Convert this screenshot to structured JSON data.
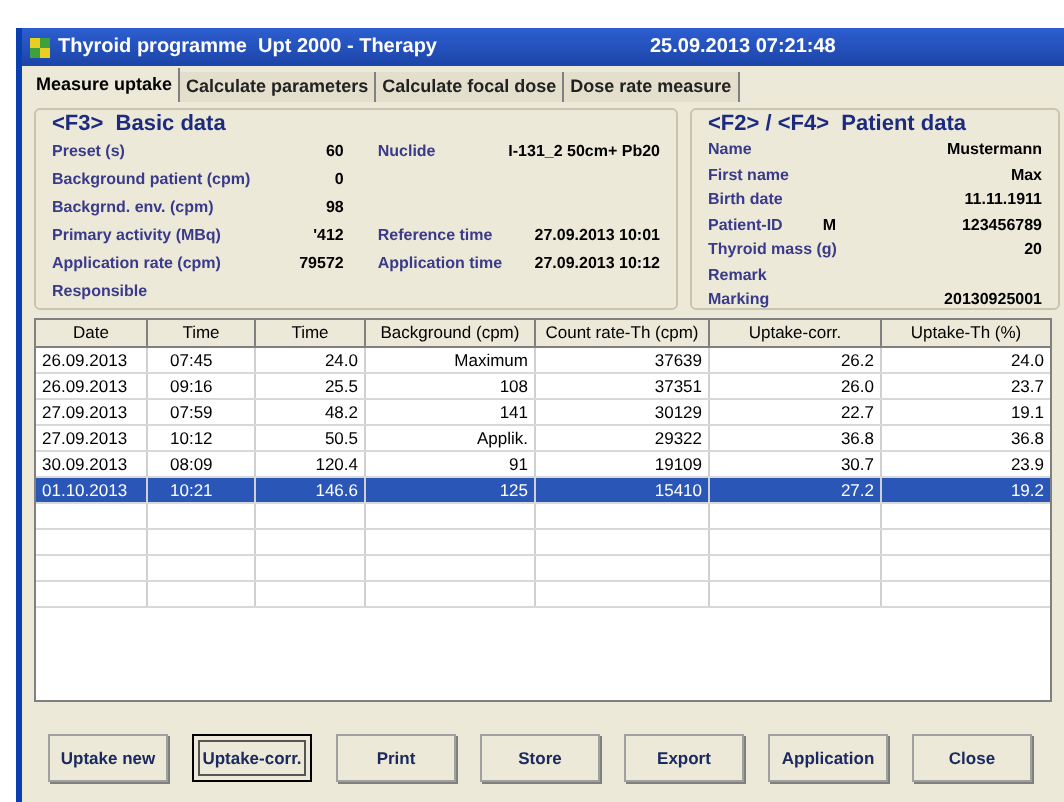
{
  "window": {
    "title": "Thyroid programme  Upt 2000 - Therapy",
    "datetime": "25.09.2013 07:21:48"
  },
  "tabs": [
    {
      "label": "Measure uptake",
      "selected": true
    },
    {
      "label": "Calculate parameters",
      "selected": false
    },
    {
      "label": "Calculate focal dose",
      "selected": false
    },
    {
      "label": "Dose rate measure",
      "selected": false
    }
  ],
  "basic_data": {
    "title": "<F3>  Basic data",
    "fields": [
      {
        "label": "Preset (s)",
        "value": "60"
      },
      {
        "label": "Background patient (cpm)",
        "value": "0"
      },
      {
        "label": "Backgrnd. env. (cpm)",
        "value": "98"
      },
      {
        "label": "Primary activity (MBq)",
        "value": "'412"
      },
      {
        "label": "Application rate (cpm)",
        "value": "79572"
      },
      {
        "label": "Responsible"
      }
    ],
    "side_fields": [
      {
        "label": "Nuclide",
        "value": "I-131_2 50cm+ Pb20"
      },
      {
        "label": "Reference time",
        "value": "27.09.2013 10:01"
      },
      {
        "label": "Application time",
        "value": "27.09.2013 10:12"
      }
    ]
  },
  "patient_data": {
    "title": "<F2> / <F4>  Patient data",
    "fields": [
      {
        "label": "Name",
        "value": "Mustermann"
      },
      {
        "label": "First name",
        "value": "Max"
      },
      {
        "label": "Birth date",
        "value": "11.11.1911"
      },
      {
        "label": "Patient-ID",
        "extra": "M",
        "value": "123456789"
      },
      {
        "label": "Thyroid mass (g)",
        "value": "20"
      },
      {
        "label": "Remark"
      },
      {
        "label": "Marking",
        "value": "20130925001"
      }
    ]
  },
  "table": {
    "columns": [
      "Date",
      "Time",
      "Time",
      "Background (cpm)",
      "Count rate-Th (cpm)",
      "Uptake-corr.",
      "Uptake-Th (%)"
    ],
    "rows": [
      {
        "cells": [
          "26.09.2013",
          "07:45",
          "24.0",
          "Maximum",
          "37639",
          "26.2",
          "24.0"
        ],
        "selected": false
      },
      {
        "cells": [
          "26.09.2013",
          "09:16",
          "25.5",
          "108",
          "37351",
          "26.0",
          "23.7"
        ],
        "selected": false
      },
      {
        "cells": [
          "27.09.2013",
          "07:59",
          "48.2",
          "141",
          "30129",
          "22.7",
          "19.1"
        ],
        "selected": false
      },
      {
        "cells": [
          "27.09.2013",
          "10:12",
          "50.5",
          "Applik.",
          "29322",
          "36.8",
          "36.8"
        ],
        "selected": false
      },
      {
        "cells": [
          "30.09.2013",
          "08:09",
          "120.4",
          "91",
          "19109",
          "30.7",
          "23.9"
        ],
        "selected": false
      },
      {
        "cells": [
          "01.10.2013",
          "10:21",
          "146.6",
          "125",
          "15410",
          "27.2",
          "19.2"
        ],
        "selected": true
      }
    ]
  },
  "buttons": [
    {
      "label": "Uptake new",
      "focused": false
    },
    {
      "label": "Uptake-corr.",
      "focused": true
    },
    {
      "label": "Print",
      "focused": false
    },
    {
      "label": "Store",
      "focused": false
    },
    {
      "label": "Export",
      "focused": false
    },
    {
      "label": "Application",
      "focused": false
    },
    {
      "label": "Close",
      "focused": false
    }
  ]
}
